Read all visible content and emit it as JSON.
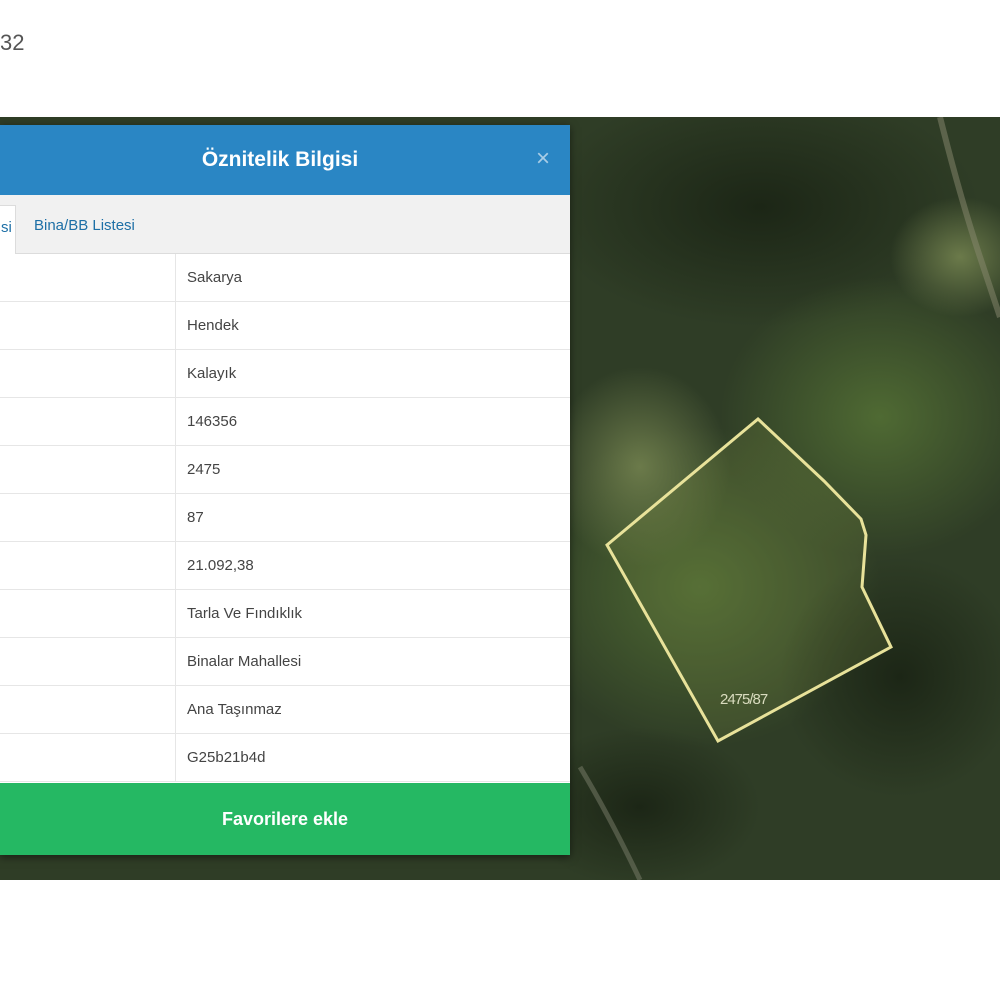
{
  "page": {
    "id_fragment": "32"
  },
  "dialog": {
    "title": "Öznitelik Bilgisi",
    "close_symbol": "×",
    "tabs": [
      {
        "label": "si",
        "active": true
      },
      {
        "label": "Bina/BB Listesi",
        "active": false
      }
    ],
    "rows": [
      {
        "key": "",
        "value": "Sakarya"
      },
      {
        "key": "",
        "value": "Hendek"
      },
      {
        "key": "",
        "value": "Kalayık"
      },
      {
        "key": "",
        "value": "146356"
      },
      {
        "key": "",
        "value": "2475"
      },
      {
        "key": "",
        "value": "87"
      },
      {
        "key": "",
        "value": "21.092,38"
      },
      {
        "key": "",
        "value": "Tarla Ve Fındıklık"
      },
      {
        "key": "",
        "value": "Binalar Mahallesi"
      },
      {
        "key": "",
        "value": "Ana Taşınmaz"
      },
      {
        "key": "",
        "value": "G25b21b4d"
      }
    ],
    "favorite_button": "Favorilere ekle"
  },
  "map": {
    "parcel_label": "2475/87",
    "parcel_outline_color": "#e8e29a",
    "imagery_base_color": "#2d3b24"
  },
  "colors": {
    "header": "#2a86c4",
    "button": "#25b863",
    "tab_text": "#1d6fa6"
  }
}
